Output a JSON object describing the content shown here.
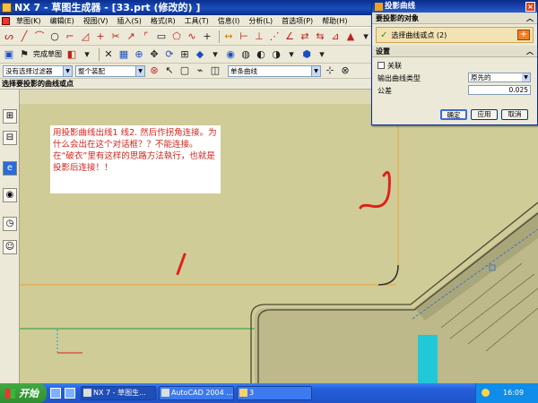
{
  "window": {
    "title": "NX 7 - 草图生成器 - [33.prt  (修改的) ]"
  },
  "menu": {
    "items": [
      "草图(K)",
      "编辑(E)",
      "视图(V)",
      "插入(S)",
      "格式(R)",
      "工具(T)",
      "信息(I)",
      "分析(L)",
      "首选项(P)",
      "帮助(H)"
    ]
  },
  "toolbar2": {
    "finish_sketch": "完成草图"
  },
  "toolbar3": {
    "filter_value": "没有选择过滤器",
    "assembly_value": "整个装配"
  },
  "right_combo": {
    "value": "单条曲线"
  },
  "prompt": {
    "text": "选择要投影的曲线或点"
  },
  "dialog": {
    "title": "投影曲线",
    "section_objects": "要投影的对象",
    "select_label": "选择曲线或点 (2)",
    "section_settings": "设置",
    "associative_label": "关联",
    "output_type_label": "输出曲线类型",
    "output_type_value": "原先的",
    "tolerance_label": "公差",
    "tolerance_value": "0.025",
    "ok": "确定",
    "apply": "应用",
    "cancel": "取消"
  },
  "note": {
    "text": "用投影曲线出线1 线2. 然后作拐角连接。为什么会出在这个对话框？？不能连接。在“破衣”里有这样的思路方法執行，也就是投影后连接！！"
  },
  "taskbar": {
    "start": "开始",
    "tasks": [
      "NX 7 - 草图生...",
      "AutoCAD 2004 ...",
      "3"
    ],
    "clock": "16:09"
  },
  "colors": {
    "canvas": "#cfcc97",
    "note_text": "#d2241c",
    "title_bar": "#0b2f8c",
    "orange_line": "#f0a030",
    "cyan_solid": "#20c8d8"
  }
}
